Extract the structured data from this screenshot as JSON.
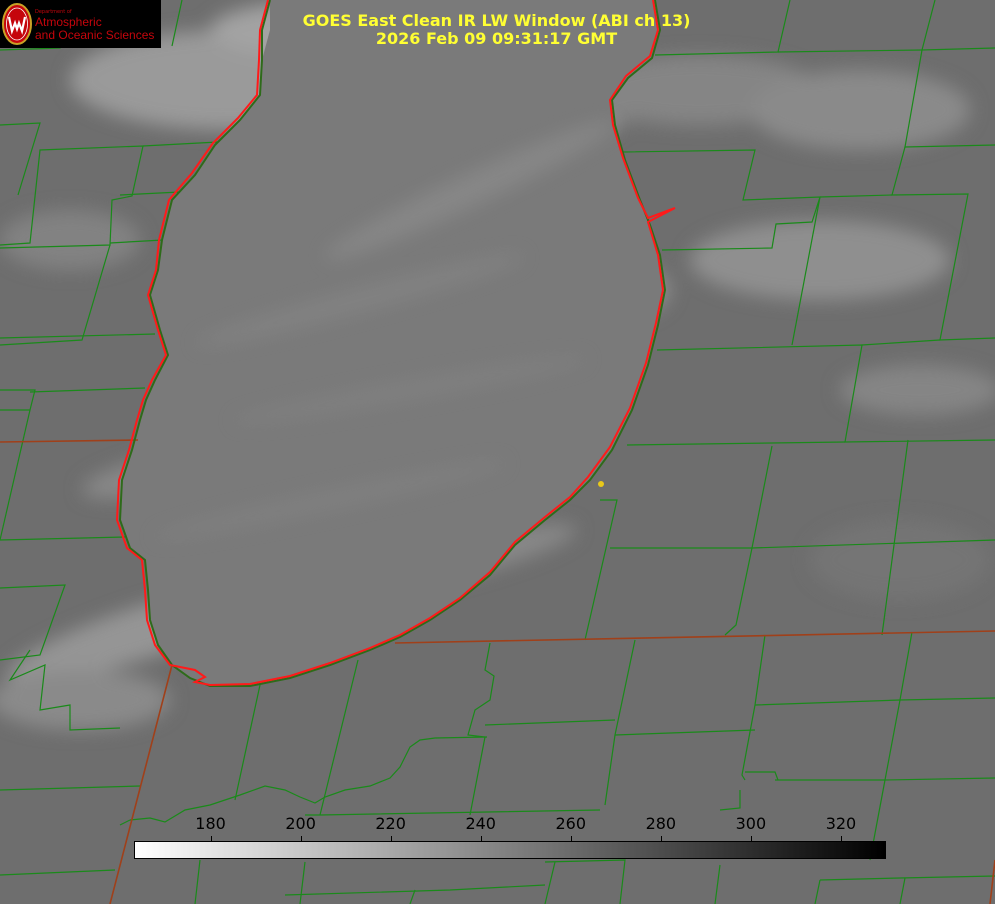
{
  "header": {
    "line1": "GOES East Clean IR LW Window (ABI ch 13)",
    "line2": "2026 Feb 09 09:31:17 GMT"
  },
  "logo": {
    "dept": "Department of",
    "line1": "Atmospheric",
    "line2": "and Oceanic Sciences"
  },
  "colorbar": {
    "min": 163,
    "max": 330,
    "ticks": [
      "180",
      "200",
      "220",
      "240",
      "260",
      "280",
      "300",
      "320"
    ],
    "gradient": [
      "#ffffff",
      "#000000"
    ]
  },
  "colors": {
    "background": "#6b6b6b",
    "lake_fill": "#7a7a7a",
    "county_lines": "#1a8a1a",
    "shoreline": "#ff1a1a",
    "state_lines": "#a0401a",
    "title": "#ffff33",
    "marker": "#e8c81a"
  }
}
